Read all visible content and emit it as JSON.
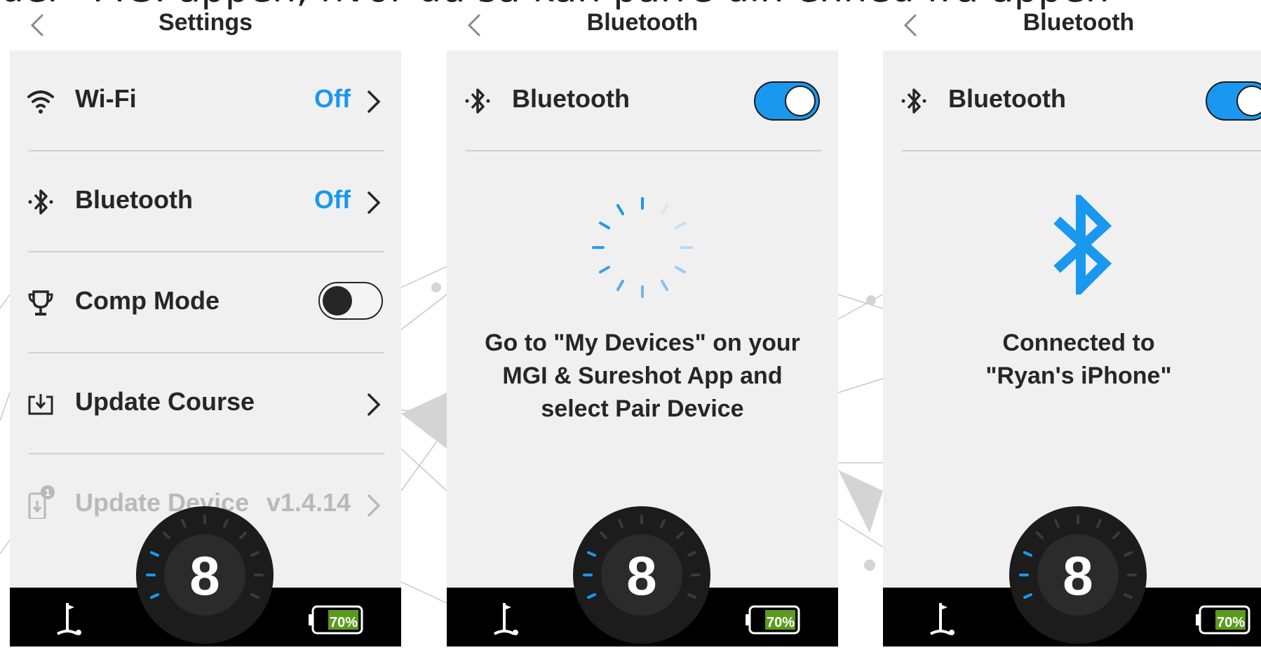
{
  "caption": "der \"MGI appen, hvor du så kan parre din enhed fra appen",
  "colors": {
    "accent": "#1a97ee",
    "panel": "#f0f0f0",
    "text": "#262626",
    "disabled": "#b9b9b9",
    "battery_fill": "#5b9a1e"
  },
  "screens": [
    {
      "title": "Settings",
      "rows": [
        {
          "icon": "wifi-icon",
          "label": "Wi-Fi",
          "value": "Off"
        },
        {
          "icon": "bluetooth-icon",
          "label": "Bluetooth",
          "value": "Off"
        },
        {
          "icon": "trophy-icon",
          "label": "Comp Mode",
          "toggle": "off"
        },
        {
          "icon": "download-icon",
          "label": "Update Course"
        },
        {
          "icon": "device-update-icon",
          "label": "Update Device",
          "value": "v1.4.14",
          "badge": "1",
          "disabled": true
        }
      ],
      "dial_number": "8",
      "battery": "70%"
    },
    {
      "title": "Bluetooth",
      "toggle_label": "Bluetooth",
      "toggle": "on",
      "status_icon": "loading-spinner-icon",
      "message": [
        "Go to \"My Devices\" on your",
        "MGI & Sureshot App and",
        "select Pair Device"
      ],
      "dial_number": "8",
      "battery": "70%"
    },
    {
      "title": "Bluetooth",
      "toggle_label": "Bluetooth",
      "toggle": "on",
      "status_icon": "bluetooth-icon",
      "message": [
        "Connected to",
        "\"Ryan's iPhone\""
      ],
      "dial_number": "8",
      "battery": "70%"
    }
  ]
}
